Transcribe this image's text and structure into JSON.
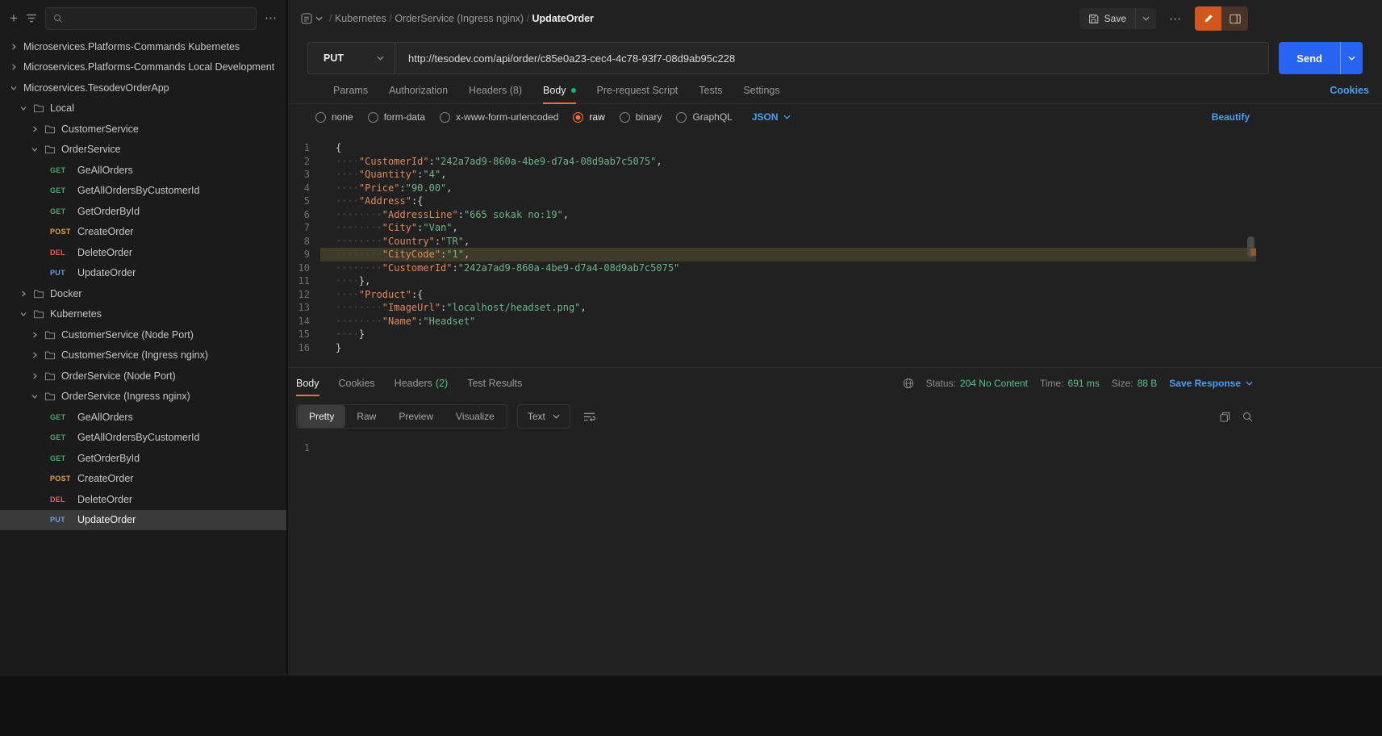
{
  "colors": {
    "accent_orange": "#ff6c37",
    "link_blue": "#4a9df8",
    "green": "#55c187",
    "method_get": "#49a96d",
    "method_post": "#e8a33d",
    "method_del": "#e35f52",
    "method_put": "#6d9ee8",
    "send_blue": "#2864f0"
  },
  "sidebar": {
    "plus_icon": "+",
    "more_icon": "⋯",
    "search_placeholder": "",
    "tree": [
      {
        "type": "collection",
        "chevron": "right",
        "indent": 0,
        "label": "Microservices.Platforms-Commands Kubernetes"
      },
      {
        "type": "collection",
        "chevron": "right",
        "indent": 0,
        "label": "Microservices.Platforms-Commands Local Development"
      },
      {
        "type": "collection",
        "chevron": "down",
        "indent": 0,
        "label": "Microservices.TesodevOrderApp"
      },
      {
        "type": "folder",
        "chevron": "down",
        "indent": 1,
        "label": "Local"
      },
      {
        "type": "folder",
        "chevron": "right",
        "indent": 2,
        "label": "CustomerService"
      },
      {
        "type": "folder",
        "chevron": "down",
        "indent": 2,
        "label": "OrderService"
      },
      {
        "type": "request",
        "method": "GET",
        "indent": 3,
        "label": "GeAllOrders"
      },
      {
        "type": "request",
        "method": "GET",
        "indent": 3,
        "label": "GetAllOrdersByCustomerId"
      },
      {
        "type": "request",
        "method": "GET",
        "indent": 3,
        "label": "GetOrderById"
      },
      {
        "type": "request",
        "method": "POST",
        "indent": 3,
        "label": "CreateOrder"
      },
      {
        "type": "request",
        "method": "DEL",
        "indent": 3,
        "label": "DeleteOrder"
      },
      {
        "type": "request",
        "method": "PUT",
        "indent": 3,
        "label": "UpdateOrder"
      },
      {
        "type": "folder",
        "chevron": "right",
        "indent": 1,
        "label": "Docker"
      },
      {
        "type": "folder",
        "chevron": "down",
        "indent": 1,
        "label": "Kubernetes"
      },
      {
        "type": "folder",
        "chevron": "right",
        "indent": 2,
        "label": "CustomerService (Node Port)"
      },
      {
        "type": "folder",
        "chevron": "right",
        "indent": 2,
        "label": "CustomerService (Ingress nginx)"
      },
      {
        "type": "folder",
        "chevron": "right",
        "indent": 2,
        "label": "OrderService (Node Port)"
      },
      {
        "type": "folder",
        "chevron": "down",
        "indent": 2,
        "label": "OrderService (Ingress nginx)"
      },
      {
        "type": "request",
        "method": "GET",
        "indent": 3,
        "label": "GeAllOrders"
      },
      {
        "type": "request",
        "method": "GET",
        "indent": 3,
        "label": "GetAllOrdersByCustomerId"
      },
      {
        "type": "request",
        "method": "GET",
        "indent": 3,
        "label": "GetOrderById"
      },
      {
        "type": "request",
        "method": "POST",
        "indent": 3,
        "label": "CreateOrder"
      },
      {
        "type": "request",
        "method": "DEL",
        "indent": 3,
        "label": "DeleteOrder"
      },
      {
        "type": "request",
        "method": "PUT",
        "indent": 3,
        "label": "UpdateOrder",
        "selected": true
      }
    ]
  },
  "breadcrumb": {
    "separator": "/",
    "items": [
      "Kubernetes",
      "OrderService (Ingress nginx)",
      "UpdateOrder"
    ]
  },
  "header": {
    "save_label": "Save",
    "more_icon": "⋯"
  },
  "request": {
    "method": "PUT",
    "url": "http://tesodev.com/api/order/c85e0a23-cec4-4c78-93f7-08d9ab95c228",
    "send_label": "Send",
    "cookies_link": "Cookies",
    "tabs": [
      {
        "label": "Params"
      },
      {
        "label": "Authorization"
      },
      {
        "label": "Headers (8)"
      },
      {
        "label": "Body",
        "active": true,
        "dot": true
      },
      {
        "label": "Pre-request Script"
      },
      {
        "label": "Tests"
      },
      {
        "label": "Settings"
      }
    ],
    "body_modes": [
      {
        "label": "none"
      },
      {
        "label": "form-data"
      },
      {
        "label": "x-www-form-urlencoded"
      },
      {
        "label": "raw",
        "selected": true
      },
      {
        "label": "binary"
      },
      {
        "label": "GraphQL"
      }
    ],
    "language": "JSON",
    "beautify_link": "Beautify",
    "editor": {
      "lines": [
        {
          "i": 0,
          "t": [
            [
              "p",
              "{"
            ]
          ]
        },
        {
          "i": 4,
          "t": [
            [
              "k",
              "\"CustomerId\""
            ],
            [
              "p",
              ":"
            ],
            [
              "s",
              "\"242a7ad9-860a-4be9-d7a4-08d9ab7c5075\""
            ],
            [
              "p",
              ","
            ]
          ]
        },
        {
          "i": 4,
          "t": [
            [
              "k",
              "\"Quantity\""
            ],
            [
              "p",
              ":"
            ],
            [
              "s",
              "\"4\""
            ],
            [
              "p",
              ","
            ]
          ]
        },
        {
          "i": 4,
          "t": [
            [
              "k",
              "\"Price\""
            ],
            [
              "p",
              ":"
            ],
            [
              "s",
              "\"90.00\""
            ],
            [
              "p",
              ","
            ]
          ]
        },
        {
          "i": 4,
          "t": [
            [
              "k",
              "\"Address\""
            ],
            [
              "p",
              ":{"
            ]
          ]
        },
        {
          "i": 8,
          "t": [
            [
              "k",
              "\"AddressLine\""
            ],
            [
              "p",
              ":"
            ],
            [
              "s",
              "\"665 sokak no:19\""
            ],
            [
              "p",
              ","
            ]
          ]
        },
        {
          "i": 8,
          "t": [
            [
              "k",
              "\"City\""
            ],
            [
              "p",
              ":"
            ],
            [
              "s",
              "\"Van\""
            ],
            [
              "p",
              ","
            ]
          ]
        },
        {
          "i": 8,
          "t": [
            [
              "k",
              "\"Country\""
            ],
            [
              "p",
              ":"
            ],
            [
              "s",
              "\"TR\""
            ],
            [
              "p",
              ","
            ]
          ]
        },
        {
          "i": 8,
          "h": true,
          "t": [
            [
              "k",
              "\"CityCode\""
            ],
            [
              "p",
              ":"
            ],
            [
              "s",
              "\"1\""
            ],
            [
              "p",
              ","
            ]
          ]
        },
        {
          "i": 8,
          "t": [
            [
              "k",
              "\"CustomerId\""
            ],
            [
              "p",
              ":"
            ],
            [
              "s",
              "\"242a7ad9-860a-4be9-d7a4-08d9ab7c5075\""
            ]
          ]
        },
        {
          "i": 4,
          "t": [
            [
              "p",
              "},"
            ]
          ]
        },
        {
          "i": 4,
          "t": [
            [
              "k",
              "\"Product\""
            ],
            [
              "p",
              ":{"
            ]
          ]
        },
        {
          "i": 8,
          "t": [
            [
              "k",
              "\"ImageUrl\""
            ],
            [
              "p",
              ":"
            ],
            [
              "s",
              "\"localhost/headset.png\""
            ],
            [
              "p",
              ","
            ]
          ]
        },
        {
          "i": 8,
          "t": [
            [
              "k",
              "\"Name\""
            ],
            [
              "p",
              ":"
            ],
            [
              "s",
              "\"Headset\""
            ]
          ]
        },
        {
          "i": 4,
          "t": [
            [
              "p",
              "}"
            ]
          ]
        },
        {
          "i": 0,
          "t": [
            [
              "p",
              "}"
            ]
          ]
        }
      ]
    }
  },
  "response": {
    "tabs": [
      {
        "label": "Body",
        "active": true
      },
      {
        "label": "Cookies"
      },
      {
        "label": "Headers",
        "count": "(2)"
      },
      {
        "label": "Test Results"
      }
    ],
    "status_label": "Status:",
    "status_value": "204 No Content",
    "time_label": "Time:",
    "time_value": "691 ms",
    "size_label": "Size:",
    "size_value": "88 B",
    "save_response": "Save Response",
    "views": [
      {
        "label": "Pretty",
        "active": true
      },
      {
        "label": "Raw"
      },
      {
        "label": "Preview"
      },
      {
        "label": "Visualize"
      }
    ],
    "format": "Text",
    "editor_lines": [
      ""
    ]
  }
}
